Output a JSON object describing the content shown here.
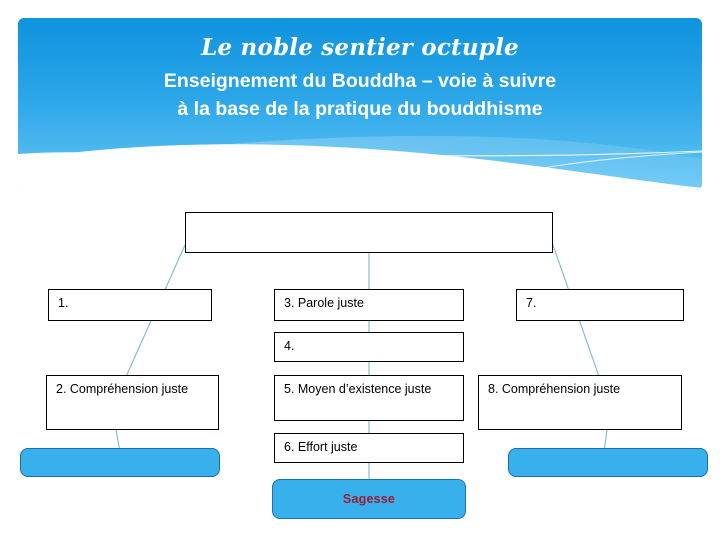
{
  "header": {
    "title": "Le noble sentier octuple",
    "subtitle_line1": "Enseignement du Bouddha – voie à suivre",
    "subtitle_line2": "à la base de la pratique du bouddhisme",
    "panel_color_top": "#0f93de",
    "panel_color_bottom": "#64c6f4",
    "text_color": "#ffffff"
  },
  "diagram": {
    "type": "hierarchy",
    "node_border_color": "#000000",
    "node_fill_color": "#ffffff",
    "connector_color": "#7fb8cc",
    "nodes": {
      "root": {
        "label": ""
      },
      "col_left": [
        {
          "label": "1."
        },
        {
          "label": "2. Compréhension juste"
        }
      ],
      "col_center": [
        {
          "label": "3. Parole juste"
        },
        {
          "label": "4."
        },
        {
          "label": "5. Moyen d’existence juste"
        },
        {
          "label": "6. Effort juste"
        }
      ],
      "col_right": [
        {
          "label": "7."
        },
        {
          "label": "8. Compréhension juste"
        }
      ]
    },
    "pills": [
      {
        "label": "",
        "fill": "#38b0ec",
        "border": "#1f6fa8",
        "text_color": "#9e1b35"
      },
      {
        "label": "Sagesse",
        "fill": "#38b0ec",
        "border": "#1f6fa8",
        "text_color": "#9e1b35"
      },
      {
        "label": "",
        "fill": "#38b0ec",
        "border": "#1f6fa8",
        "text_color": "#9e1b35"
      }
    ]
  }
}
